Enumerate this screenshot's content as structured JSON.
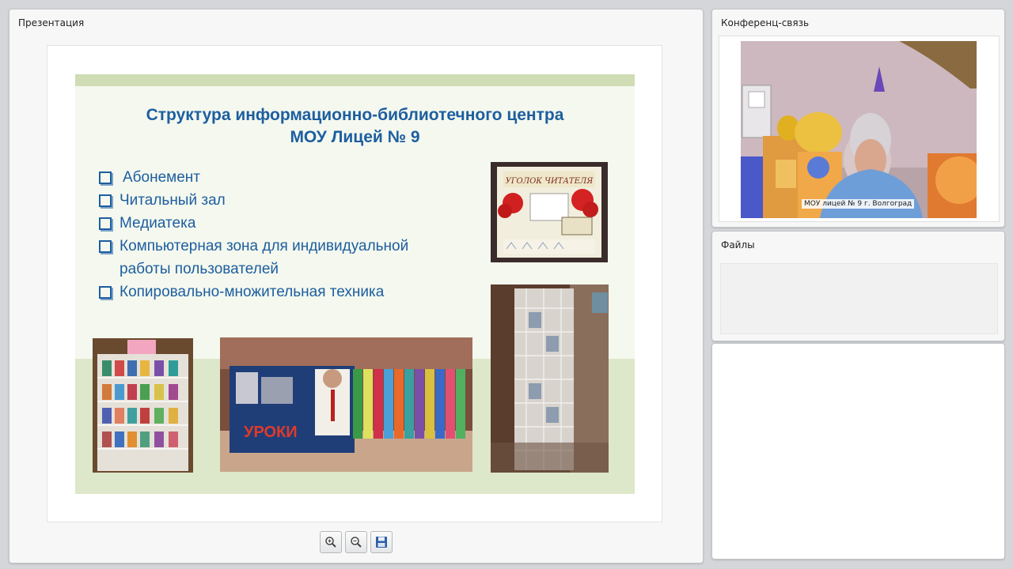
{
  "presentation": {
    "panel_title": "Презентация",
    "slide": {
      "title_line1": "Структура информационно-библиотечного центра",
      "title_line2": "МОУ Лицей № 9",
      "bullets": [
        "Абонемент",
        "Читальный зал",
        "Медиатека",
        "Компьютерная зона для индивидуальной",
        "работы пользователей",
        "Копировально-множительная техника"
      ],
      "photo_poster_text": "УГОЛОК ЧИТАТЕЛЯ",
      "photo_books_text": "УРОКИ"
    },
    "toolbar": {
      "zoom_in_icon": "zoom-in-icon",
      "zoom_out_icon": "zoom-out-icon",
      "save_icon": "floppy-disk-icon"
    }
  },
  "conference": {
    "panel_title": "Конференц-связь",
    "video_caption": "МОУ лицей № 9 г. Волгоград"
  },
  "files": {
    "panel_title": "Файлы"
  },
  "colors": {
    "slide_text": "#1d5ea0",
    "slide_band": "#cfdcb4",
    "background": "#d4d6d9"
  }
}
